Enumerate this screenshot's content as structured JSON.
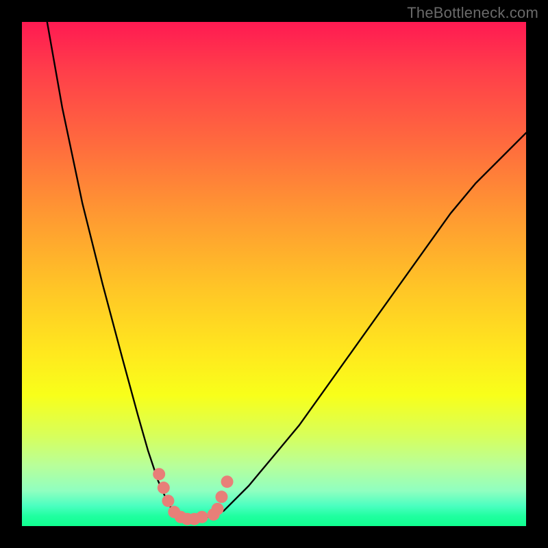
{
  "watermark": "TheBottleneck.com",
  "colors": {
    "frame_bg": "#000000",
    "gradient_top": "#ff1a52",
    "gradient_mid": "#ffe91e",
    "gradient_bottom": "#10ff90",
    "curve_stroke": "#000000",
    "marker_fill": "#e87f78",
    "marker_stroke": "#b24a44"
  },
  "chart_data": {
    "type": "line",
    "title": "",
    "xlabel": "",
    "ylabel": "",
    "xlim": [
      0,
      100
    ],
    "ylim": [
      0,
      100
    ],
    "grid": false,
    "legend": false,
    "series": [
      {
        "name": "curve",
        "x": [
          5,
          8,
          12,
          16,
          20,
          23,
          25,
          27,
          29,
          30,
          32,
          34,
          36,
          40,
          45,
          50,
          55,
          60,
          65,
          70,
          75,
          80,
          85,
          90,
          95,
          100
        ],
        "y": [
          100,
          83,
          64,
          48,
          33,
          22,
          15,
          9,
          4.5,
          3,
          1.5,
          1,
          1.5,
          3,
          8,
          14,
          20,
          27,
          34,
          41,
          48,
          55,
          62,
          68,
          73,
          78
        ]
      }
    ],
    "markers": [
      {
        "x": 27.2,
        "y": 10.3
      },
      {
        "x": 28.1,
        "y": 7.6
      },
      {
        "x": 29.0,
        "y": 5.0
      },
      {
        "x": 30.2,
        "y": 2.8
      },
      {
        "x": 31.5,
        "y": 1.8
      },
      {
        "x": 32.8,
        "y": 1.4
      },
      {
        "x": 34.2,
        "y": 1.4
      },
      {
        "x": 35.7,
        "y": 1.8
      },
      {
        "x": 38.0,
        "y": 2.3
      },
      {
        "x": 38.8,
        "y": 3.4
      },
      {
        "x": 39.6,
        "y": 5.8
      },
      {
        "x": 40.7,
        "y": 8.8
      }
    ],
    "annotations": []
  }
}
